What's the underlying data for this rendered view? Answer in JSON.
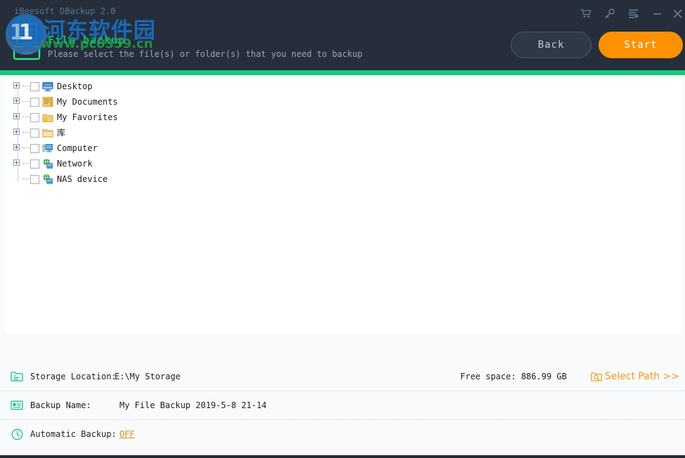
{
  "window": {
    "title": "iBeesoft DBackup 2.0",
    "titlebar_icons": [
      {
        "name": "cart-icon",
        "label": "Store"
      },
      {
        "name": "key-icon",
        "label": "Register"
      },
      {
        "name": "menu-icon",
        "label": "Menu"
      },
      {
        "name": "minimize-icon",
        "label": "Minimize"
      },
      {
        "name": "close-icon",
        "label": "Close"
      }
    ]
  },
  "header": {
    "logo_name": "backup-computer-logo",
    "title": "File backup",
    "subtitle": "Please select the file(s) or folder(s) that you need to backup",
    "back_label": "Back",
    "start_label": "Start",
    "accent_color": "#13cb7a",
    "background_color": "#252e3a",
    "title_color": "#16b765",
    "start_color": "#fb9103"
  },
  "watermark": {
    "chinese": "河东软件园",
    "url": "www.pc0359.cn",
    "chinese_color": "#1a6fc4",
    "url_color": "#1f9a4a"
  },
  "tree": {
    "items": [
      {
        "label": "Desktop",
        "icon": "desktop-icon",
        "expandable": true,
        "checked": false
      },
      {
        "label": "My Documents",
        "icon": "documents-icon",
        "expandable": true,
        "checked": false
      },
      {
        "label": "My Favorites",
        "icon": "favorites-icon",
        "expandable": true,
        "checked": false
      },
      {
        "label": "库",
        "icon": "library-icon",
        "expandable": true,
        "checked": false
      },
      {
        "label": "Computer",
        "icon": "computer-icon",
        "expandable": true,
        "checked": false
      },
      {
        "label": "Network",
        "icon": "network-icon",
        "expandable": true,
        "checked": false
      },
      {
        "label": "NAS device",
        "icon": "nas-device-icon",
        "expandable": false,
        "checked": false
      }
    ]
  },
  "info": {
    "storage_label": "Storage Location:",
    "storage_value": "E:\\My Storage",
    "free_space": "Free space: 886.99 GB",
    "select_path_label": "Select Path >>",
    "select_path_icon": "folder-search-icon",
    "backup_name_label": "Backup Name:",
    "backup_name_value": "My File Backup 2019-5-8 21-14",
    "auto_backup_label": "Automatic Backup:",
    "auto_backup_value": "OFF",
    "accent_orange": "#f4991b"
  }
}
